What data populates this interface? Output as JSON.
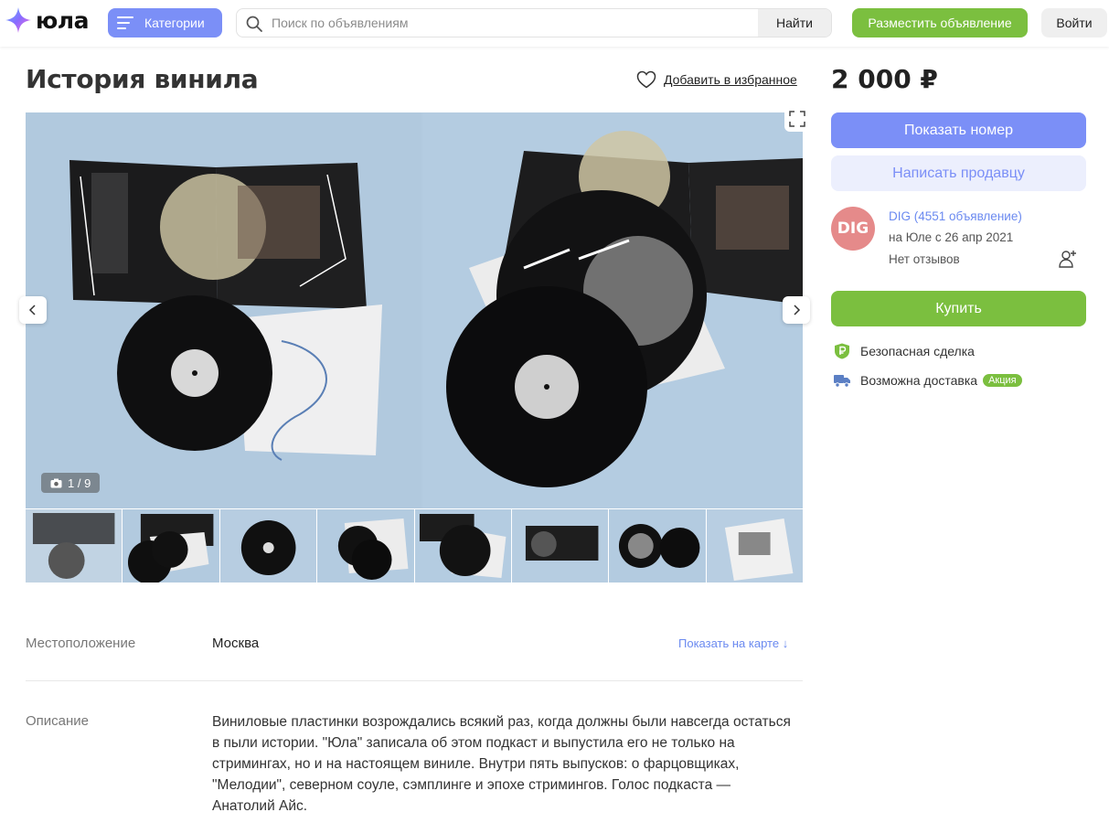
{
  "header": {
    "logo_text": "юла",
    "categories_label": "Категории",
    "search_placeholder": "Поиск по объявлениям",
    "search_button": "Найти",
    "post_button": "Разместить объявление",
    "login_button": "Войти"
  },
  "listing": {
    "title": "История винила",
    "favorite_label": "Добавить в избранное",
    "price": "2 000 ₽",
    "photo_counter": "1 / 9",
    "thumbnail_count": 8
  },
  "actions": {
    "show_phone": "Показать номер",
    "message_seller": "Написать продавцу",
    "buy": "Купить"
  },
  "seller": {
    "avatar_text": "DIG",
    "name": "DIG (4551 объявление)",
    "since": "на Юле с 26 апр 2021",
    "reviews": "Нет отзывов"
  },
  "features": {
    "safe_deal": "Безопасная сделка",
    "delivery": "Возможна доставка",
    "promo_badge": "Акция"
  },
  "details": {
    "location_label": "Местоположение",
    "location_value": "Москва",
    "map_link": "Показать на карте ↓",
    "description_label": "Описание",
    "description_text": "Виниловые пластинки возрождались всякий раз, когда должны были навсегда остаться в пыли истории. \"Юла\" записала об этом подкаст и выпустила его не только на стримингах, но и на настоящем виниле. Внутри пять выпусков: о фарцовщиках, \"Мелодии\", северном соуле, сэмплинге и эпохе стримингов. Голос подкаста — Анатолий Айс."
  },
  "colors": {
    "accent_blue": "#7b8ff7",
    "accent_green": "#7bbf3f",
    "link_blue": "#6b8af0",
    "avatar_bg": "#e58a8a",
    "photo_bg": "#b3cbe0"
  }
}
